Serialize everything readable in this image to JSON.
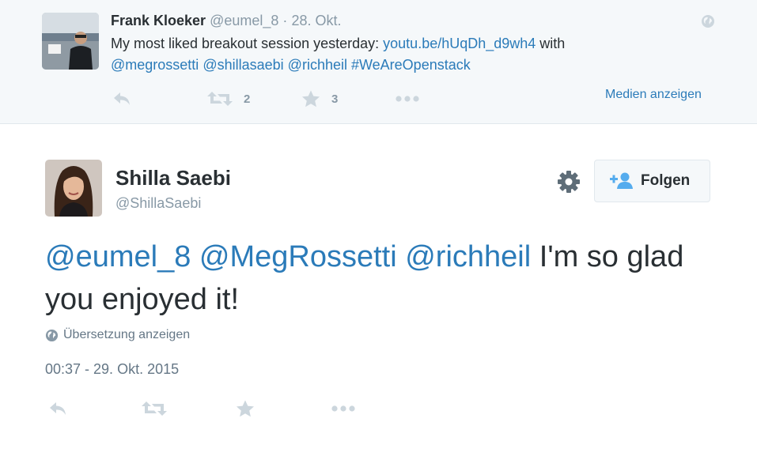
{
  "parent_tweet": {
    "author_name": "Frank Kloeker",
    "author_handle": "@eumel_8",
    "separator": "·",
    "date": "28. Okt.",
    "text_prefix": "My most liked breakout session yesterday: ",
    "link": "youtu.be/hUqDh_d9wh4",
    "text_with": " with",
    "mentions": [
      "@megrossetti",
      "@shillasaebi",
      "@richheil"
    ],
    "hashtag": "#WeAreOpenstack",
    "retweet_count": "2",
    "favorite_count": "3",
    "media_link_label": "Medien anzeigen",
    "icons": [
      "reply-icon",
      "retweet-icon",
      "favorite-star-icon",
      "more-dots-icon",
      "globe-icon"
    ]
  },
  "main_tweet": {
    "author_name": "Shilla Saebi",
    "author_handle": "@ShillaSaebi",
    "follow_label": "Folgen",
    "mentions": [
      "@eumel_8",
      "@MegRossetti",
      "@richheil"
    ],
    "text": "I'm so glad you enjoyed it!",
    "translate_label": "Übersetzung anzeigen",
    "timestamp": "00:37 - 29. Okt. 2015",
    "icons": [
      "gear-icon",
      "follow-person-plus-icon",
      "globe-icon",
      "reply-icon",
      "retweet-icon",
      "favorite-star-icon",
      "more-dots-icon"
    ]
  },
  "colors": {
    "link": "#2b7bb9",
    "text": "#292f33",
    "muted": "#8899a6",
    "icon": "#ccd6dd",
    "parent_bg": "#f5f8fa",
    "follow_icon": "#55acee"
  }
}
